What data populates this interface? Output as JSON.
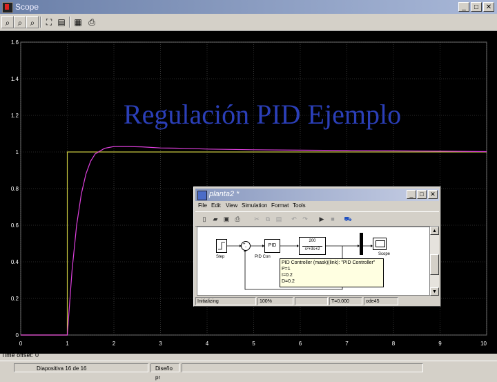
{
  "scope_window": {
    "title": "Scope",
    "toolbar": [
      {
        "name": "zoom-icon",
        "glyph": "⌕"
      },
      {
        "name": "zoom-x-icon",
        "glyph": "⌕"
      },
      {
        "name": "zoom-y-icon",
        "glyph": "⌕"
      },
      {
        "name": "autoscale-icon",
        "glyph": "⛶"
      },
      {
        "name": "save-axes-icon",
        "glyph": "▤"
      },
      {
        "name": "parameters-icon",
        "glyph": "▦"
      },
      {
        "name": "print-icon",
        "glyph": "⎙"
      }
    ],
    "window_buttons": {
      "minimize": "_",
      "maximize": "□",
      "close": "✕"
    },
    "time_offset_label": "Time offset:",
    "time_offset_value": "0"
  },
  "slide_title": "Regulación PID Ejemplo",
  "chart_data": {
    "type": "line",
    "x_ticks": [
      "0",
      "1",
      "2",
      "3",
      "4",
      "5",
      "6",
      "7",
      "8",
      "9",
      "10"
    ],
    "y_ticks": [
      "0",
      "0.2",
      "0.4",
      "0.6",
      "0.8",
      "1",
      "1.2",
      "1.4",
      "1.6"
    ],
    "xlim": [
      0,
      10
    ],
    "ylim": [
      0,
      1.6
    ],
    "grid": true,
    "series": [
      {
        "color": "#c8c840",
        "x": [
          0,
          1,
          1,
          10
        ],
        "y": [
          0,
          0,
          1,
          1
        ]
      },
      {
        "color": "#e040e0",
        "x": [
          0,
          1,
          1.1,
          1.2,
          1.3,
          1.4,
          1.5,
          1.6,
          1.8,
          2.0,
          2.3,
          2.6,
          3.0,
          3.5,
          4.0,
          5.0,
          6.0,
          7.0,
          8.0,
          9.0,
          10.0
        ],
        "y": [
          0,
          0,
          0.35,
          0.6,
          0.77,
          0.88,
          0.95,
          0.99,
          1.02,
          1.03,
          1.03,
          1.028,
          1.022,
          1.02,
          1.016,
          1.012,
          1.01,
          1.008,
          1.006,
          1.004,
          1.002
        ]
      }
    ]
  },
  "simulink_window": {
    "title": "planta2 *",
    "window_buttons": {
      "minimize": "_",
      "maximize": "□",
      "close": "✕"
    },
    "menu": [
      "File",
      "Edit",
      "View",
      "Simulation",
      "Format",
      "Tools"
    ],
    "toolbar": [
      {
        "name": "new-icon",
        "glyph": "▯",
        "enabled": true
      },
      {
        "name": "open-icon",
        "glyph": "▰",
        "enabled": true
      },
      {
        "name": "save-icon",
        "glyph": "▣",
        "enabled": true
      },
      {
        "name": "print-icon",
        "glyph": "⎙",
        "enabled": true
      },
      {
        "name": "cut-icon",
        "glyph": "✂",
        "enabled": false
      },
      {
        "name": "copy-icon",
        "glyph": "⧉",
        "enabled": false
      },
      {
        "name": "paste-icon",
        "glyph": "▤",
        "enabled": false
      },
      {
        "name": "undo-icon",
        "glyph": "↶",
        "enabled": false
      },
      {
        "name": "redo-icon",
        "glyph": "↷",
        "enabled": false
      },
      {
        "name": "start-icon",
        "glyph": "▶",
        "enabled": true
      },
      {
        "name": "stop-icon",
        "glyph": "■",
        "enabled": false
      },
      {
        "name": "library-icon",
        "glyph": "⛟",
        "enabled": true
      }
    ],
    "blocks": {
      "step_label": "Step",
      "pid_text": "PID",
      "pid_label": "PID Con",
      "tf_numerator": "200",
      "tf_denominator": "s²+3s+2",
      "scope_label": "Scope"
    },
    "tooltip": [
      "PID Controller (mask)(link): \"PID Controller\"",
      "P=1",
      "I=0.2",
      "D=0.2"
    ],
    "status": {
      "state": "Initializing",
      "zoom": "100%",
      "empty": "",
      "time": "T=0.000",
      "solver": "ode45"
    }
  },
  "slide_status": {
    "slide_counter": "Diapositiva 16 de 16",
    "design": "Diseño pr"
  }
}
